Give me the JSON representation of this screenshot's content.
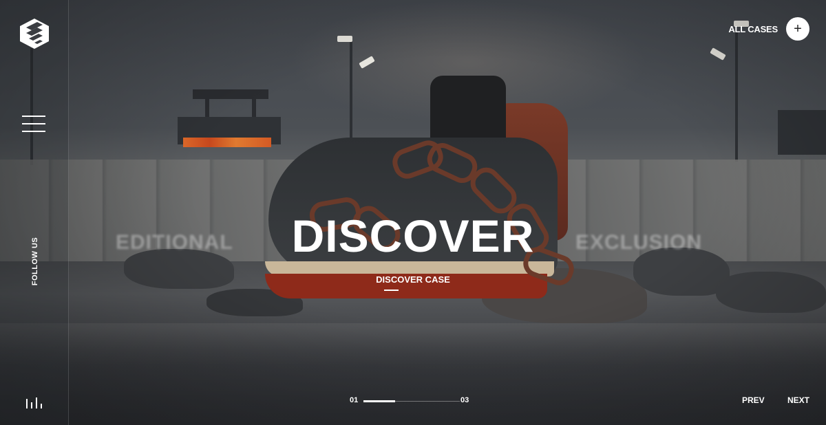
{
  "header": {
    "all_cases_label": "ALL CASES",
    "plus_icon": "+"
  },
  "sidebar": {
    "follow_label": "FOLLOW US"
  },
  "hero": {
    "title": "DISCOVER",
    "cta_label": "DISCOVER CASE",
    "ghost_left": "EDITIONAL",
    "ghost_right": "EXCLUSION"
  },
  "pagination": {
    "current": "01",
    "total": "03",
    "progress": 0.33
  },
  "nav": {
    "prev_label": "PREV",
    "next_label": "NEXT"
  }
}
